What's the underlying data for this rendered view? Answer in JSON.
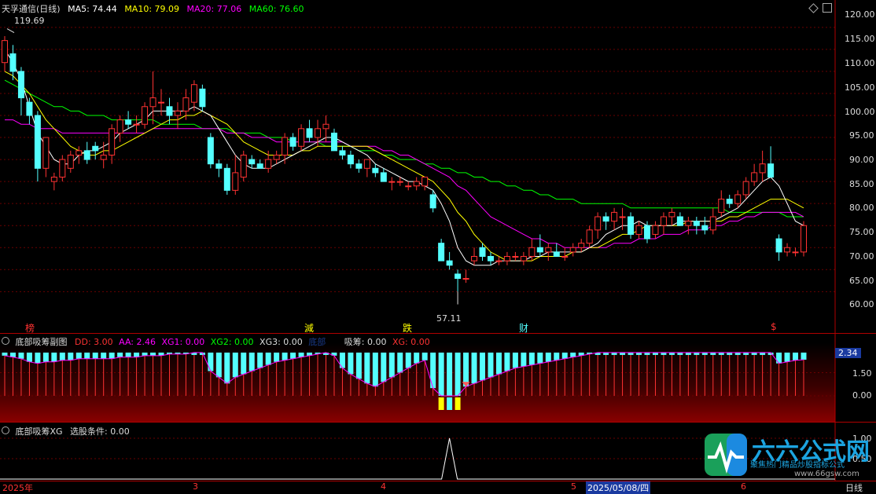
{
  "main": {
    "title": "天孚通信(日线)",
    "ma5": "MA5: 74.44",
    "ma10": "MA10: 79.09",
    "ma20": "MA20: 77.06",
    "ma60": "MA60: 76.60",
    "high_mark": "119.69",
    "low_mark": "57.11",
    "markers": [
      "榜",
      "減",
      "跌",
      "财",
      "$"
    ],
    "y_ticks": [
      "120.00",
      "115.00",
      "110.00",
      "105.00",
      "100.00",
      "95.00",
      "90.00",
      "85.00",
      "80.00",
      "75.00",
      "70.00",
      "65.00",
      "60.00"
    ]
  },
  "sub1": {
    "title": "底部吸筹副图",
    "dd": "DD: 3.00",
    "aa": "AA: 2.46",
    "xg1": "XG1: 0.00",
    "xg2": "XG2: 0.00",
    "xg3": "XG3: 0.00",
    "dibu": "底部",
    "xichou": "吸筹: 0.00",
    "xg": "XG: 0.00",
    "current": "2.34",
    "y_ticks": [
      "1.50",
      "0.00"
    ]
  },
  "sub2": {
    "title": "底部吸筹XG",
    "cond": "选股条件: 0.00",
    "y_ticks": [
      "1.00",
      "0.50"
    ]
  },
  "xaxis": {
    "labels": [
      "2025年",
      "3",
      "4",
      "5",
      "2025/05/08/四",
      "6"
    ],
    "period": "日线"
  },
  "watermark": {
    "name": "六六公式网",
    "sub": "聚焦热门精品炒股指标公式",
    "url": "www.66gsw.com"
  },
  "colors": {
    "up": "#ff3232",
    "down": "#54ffff",
    "ma5": "#ffffff",
    "ma10": "#ffff00",
    "ma20": "#ff00ff",
    "ma60": "#00ff00",
    "axis": "#b00000"
  },
  "chart_data": {
    "type": "candlestick",
    "ohlc": [
      [
        112,
        118,
        110,
        117
      ],
      [
        114,
        116,
        108,
        110
      ],
      [
        110,
        111,
        100,
        104
      ],
      [
        103,
        104,
        98,
        100
      ],
      [
        100,
        101,
        85,
        88
      ],
      [
        88,
        95,
        86,
        95
      ],
      [
        85,
        87,
        83,
        86
      ],
      [
        86,
        91,
        85,
        90
      ],
      [
        88,
        92,
        87,
        91
      ],
      [
        91,
        93,
        89,
        92
      ],
      [
        92,
        94,
        89,
        90
      ],
      [
        93,
        94,
        90,
        92
      ],
      [
        90,
        94,
        88,
        91
      ],
      [
        91,
        98,
        89,
        97
      ],
      [
        96,
        100,
        94,
        99
      ],
      [
        99,
        101,
        97,
        98
      ],
      [
        98,
        100,
        96,
        98
      ],
      [
        98,
        103,
        97,
        102
      ],
      [
        102,
        110,
        98,
        104
      ],
      [
        103,
        106,
        100,
        103
      ],
      [
        102,
        104,
        98,
        100
      ],
      [
        100,
        103,
        97,
        101
      ],
      [
        101,
        106,
        99,
        104
      ],
      [
        103,
        108,
        101,
        107
      ],
      [
        106,
        107,
        101,
        102
      ],
      [
        95,
        96,
        88,
        89
      ],
      [
        89,
        90,
        86,
        88
      ],
      [
        88,
        89,
        82,
        83
      ],
      [
        83,
        91,
        82,
        87
      ],
      [
        86,
        92,
        85,
        91
      ],
      [
        90,
        91,
        88,
        89
      ],
      [
        89,
        90,
        88,
        88
      ],
      [
        88,
        92,
        87,
        90
      ],
      [
        90,
        92,
        89,
        91
      ],
      [
        91,
        96,
        89,
        95
      ],
      [
        95,
        96,
        92,
        93
      ],
      [
        93,
        98,
        92,
        97
      ],
      [
        97,
        99,
        94,
        95
      ],
      [
        95,
        99,
        93,
        97
      ],
      [
        97,
        100,
        94,
        98
      ],
      [
        96,
        97,
        92,
        92
      ],
      [
        92,
        93,
        90,
        91
      ],
      [
        91,
        92,
        88,
        89
      ],
      [
        89,
        90,
        87,
        88
      ],
      [
        88,
        90,
        86,
        90
      ],
      [
        88,
        89,
        86,
        87
      ],
      [
        87,
        88,
        85,
        85
      ],
      [
        85,
        86,
        83,
        85
      ],
      [
        85,
        86,
        84,
        85
      ],
      [
        84,
        85,
        83,
        84
      ],
      [
        84,
        86,
        83,
        85
      ],
      [
        84,
        86,
        83,
        86
      ],
      [
        82,
        83,
        78,
        79
      ],
      [
        71,
        72,
        67,
        67
      ],
      [
        67,
        69,
        65,
        66
      ],
      [
        64,
        65,
        60,
        63
      ],
      [
        63,
        65,
        62,
        63
      ],
      [
        67,
        70,
        66,
        68
      ],
      [
        70,
        71,
        67,
        68
      ],
      [
        68,
        69,
        66,
        67
      ],
      [
        67,
        68,
        66,
        67
      ],
      [
        67,
        69,
        66,
        68
      ],
      [
        68,
        69,
        67,
        68
      ],
      [
        67,
        69,
        66,
        68
      ],
      [
        68,
        72,
        67,
        70
      ],
      [
        70,
        73,
        68,
        69
      ],
      [
        69,
        71,
        67,
        70
      ],
      [
        69,
        71,
        68,
        68
      ],
      [
        68,
        70,
        67,
        68
      ],
      [
        69,
        71,
        68,
        70
      ],
      [
        70,
        72,
        69,
        71
      ],
      [
        71,
        75,
        70,
        74
      ],
      [
        74,
        78,
        72,
        77
      ],
      [
        77,
        78,
        74,
        76
      ],
      [
        76,
        79,
        74,
        78
      ],
      [
        77,
        79,
        74,
        77
      ],
      [
        77,
        78,
        72,
        73
      ],
      [
        73,
        76,
        72,
        75
      ],
      [
        75,
        76,
        71,
        72
      ],
      [
        73,
        76,
        72,
        75
      ],
      [
        75,
        78,
        73,
        77
      ],
      [
        77,
        79,
        75,
        78
      ],
      [
        77,
        78,
        75,
        75
      ],
      [
        75,
        77,
        73,
        76
      ],
      [
        76,
        77,
        73,
        75
      ],
      [
        75,
        77,
        73,
        74
      ],
      [
        74,
        79,
        73,
        77
      ],
      [
        78,
        83,
        77,
        81
      ],
      [
        81,
        82,
        79,
        80
      ],
      [
        80,
        83,
        79,
        82
      ],
      [
        82,
        86,
        81,
        85
      ],
      [
        85,
        89,
        84,
        87
      ],
      [
        87,
        92,
        85,
        89
      ],
      [
        89,
        93,
        87,
        86
      ],
      [
        72,
        73,
        67,
        69
      ],
      [
        69,
        71,
        68,
        70
      ],
      [
        69,
        70,
        68,
        69
      ],
      [
        69,
        76,
        68,
        75
      ]
    ],
    "ma5": [
      115,
      112,
      108,
      102,
      96,
      93,
      90,
      89,
      89,
      91,
      92,
      92,
      93,
      94,
      96,
      97,
      98,
      99,
      101,
      101,
      101,
      101,
      101,
      102,
      101,
      100,
      97,
      94,
      91,
      89,
      88,
      88,
      88,
      89,
      90,
      91,
      92,
      93,
      94,
      95,
      95,
      94,
      93,
      92,
      91,
      89,
      88,
      87,
      86,
      85,
      85,
      84,
      83,
      80,
      76,
      70,
      67,
      66,
      66,
      66,
      67,
      67,
      67,
      67,
      68,
      68,
      69,
      69,
      69,
      69,
      69,
      70,
      71,
      73,
      74,
      75,
      75,
      76,
      75,
      75,
      75,
      75,
      76,
      76,
      76,
      76,
      76,
      77,
      78,
      79,
      81,
      83,
      85,
      86,
      84,
      80,
      76,
      75
    ],
    "ma10": [
      110,
      109,
      107,
      105,
      102,
      99,
      97,
      95,
      93,
      92,
      91,
      91,
      92,
      92,
      93,
      94,
      95,
      96,
      97,
      98,
      99,
      99,
      100,
      100,
      101,
      100,
      99,
      98,
      96,
      94,
      93,
      92,
      91,
      91,
      91,
      91,
      92,
      92,
      93,
      93,
      93,
      93,
      93,
      93,
      93,
      92,
      91,
      90,
      89,
      88,
      87,
      86,
      85,
      83,
      81,
      78,
      76,
      73,
      71,
      69,
      68,
      67,
      67,
      67,
      67,
      68,
      68,
      68,
      68,
      69,
      69,
      70,
      70,
      71,
      72,
      73,
      73,
      74,
      75,
      75,
      75,
      75,
      75,
      76,
      76,
      76,
      76,
      76,
      77,
      77,
      78,
      79,
      80,
      81,
      81,
      81,
      80,
      79
    ],
    "ma20": [
      99,
      99,
      98,
      98,
      97,
      97,
      97,
      96,
      96,
      96,
      96,
      96,
      96,
      96,
      96,
      96,
      96,
      96,
      97,
      97,
      97,
      97,
      97,
      97,
      97,
      97,
      97,
      96,
      96,
      96,
      95,
      95,
      95,
      94,
      94,
      94,
      94,
      94,
      94,
      94,
      94,
      94,
      93,
      93,
      93,
      93,
      92,
      92,
      91,
      91,
      90,
      89,
      88,
      87,
      86,
      84,
      83,
      81,
      79,
      77,
      76,
      75,
      74,
      73,
      72,
      72,
      71,
      71,
      70,
      70,
      70,
      70,
      70,
      70,
      71,
      71,
      71,
      72,
      72,
      72,
      73,
      73,
      73,
      74,
      74,
      74,
      75,
      75,
      76,
      76,
      77,
      77,
      78,
      78,
      78,
      78,
      78,
      77
    ],
    "ma60": [
      108,
      107,
      106,
      105,
      104,
      103,
      102,
      102,
      101,
      101,
      100,
      100,
      100,
      99,
      99,
      99,
      99,
      99,
      99,
      98,
      98,
      98,
      98,
      98,
      97,
      97,
      97,
      97,
      96,
      96,
      96,
      96,
      95,
      95,
      95,
      94,
      94,
      94,
      94,
      93,
      93,
      93,
      93,
      92,
      92,
      92,
      91,
      91,
      90,
      90,
      90,
      89,
      89,
      88,
      88,
      87,
      87,
      86,
      86,
      85,
      85,
      84,
      84,
      83,
      83,
      82,
      82,
      81,
      81,
      81,
      80,
      80,
      80,
      80,
      80,
      80,
      79,
      79,
      79,
      79,
      79,
      79,
      79,
      79,
      79,
      79,
      79,
      79,
      78,
      78,
      78,
      78,
      78,
      78,
      78,
      77,
      77,
      77
    ],
    "y_range": [
      54,
      123
    ],
    "aa_values": [
      2.6,
      2.5,
      2.4,
      2.2,
      2.1,
      2.2,
      2.2,
      2.3,
      2.3,
      2.4,
      2.4,
      2.4,
      2.4,
      2.4,
      2.5,
      2.5,
      2.5,
      2.6,
      2.6,
      2.6,
      2.7,
      2.7,
      2.7,
      2.8,
      2.8,
      1.6,
      1.2,
      0.8,
      1.2,
      1.4,
      1.6,
      1.8,
      2.0,
      2.2,
      2.3,
      2.4,
      2.5,
      2.6,
      2.7,
      2.8,
      2.6,
      1.8,
      1.4,
      1.1,
      0.8,
      0.6,
      0.9,
      1.2,
      1.5,
      1.8,
      2.1,
      2.3,
      0.5,
      -0.3,
      -0.9,
      -1.0,
      0.6,
      0.8,
      1.0,
      1.2,
      1.4,
      1.6,
      1.8,
      1.9,
      2.0,
      2.1,
      2.2,
      2.3,
      2.4,
      2.5,
      2.6,
      2.7,
      2.8,
      2.8,
      2.8,
      2.8,
      2.8,
      2.8,
      2.8,
      2.8,
      2.8,
      2.8,
      2.8,
      2.8,
      2.8,
      2.8,
      2.8,
      2.8,
      2.8,
      2.8,
      2.8,
      2.8,
      2.8,
      2.8,
      2.1,
      2.2,
      2.3,
      2.34
    ],
    "xg_signal_index": 54
  }
}
